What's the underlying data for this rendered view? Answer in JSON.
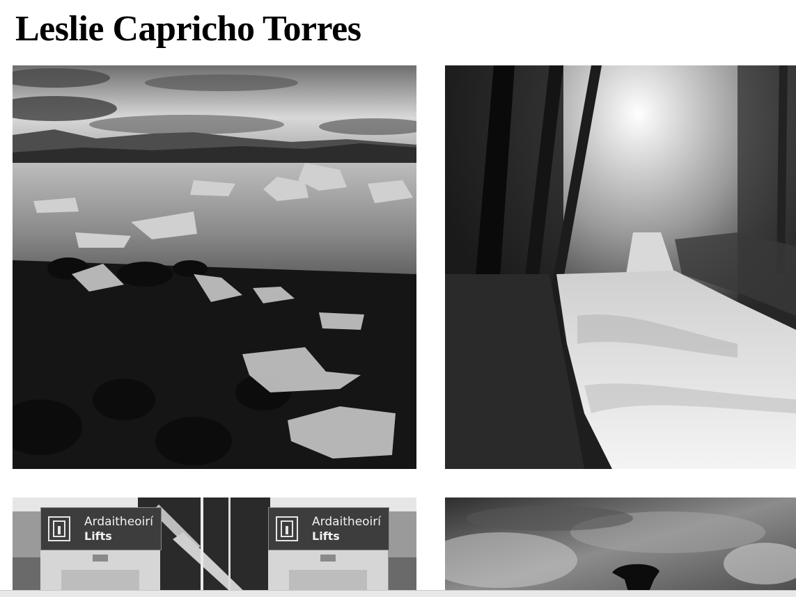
{
  "page": {
    "title": "Leslie Capricho Torres"
  },
  "gallery": {
    "photos": [
      {
        "subject": "glacier lagoon with ice chunks"
      },
      {
        "subject": "forest waterfall"
      },
      {
        "subject": "lifts signage"
      },
      {
        "subject": "cloudy sky with figure"
      }
    ],
    "signs": [
      {
        "line1": "Ardaitheoirí",
        "line2": "Lifts"
      },
      {
        "line1": "Ardaitheoirí",
        "line2": "Lifts"
      }
    ]
  }
}
